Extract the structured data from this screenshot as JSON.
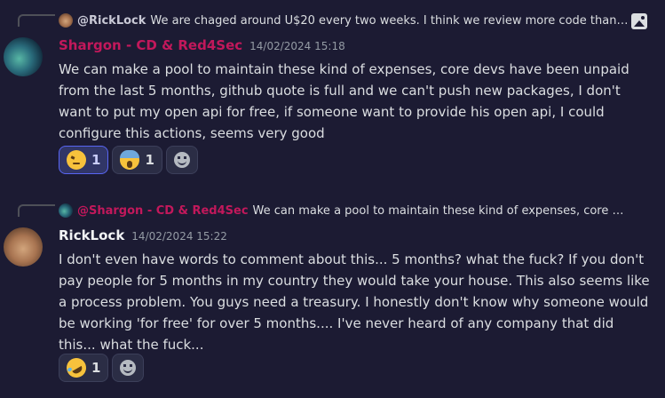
{
  "messages": [
    {
      "reply": {
        "author": "@RickLock",
        "text": "We are chaged around U$20 every two weeks. I think we review more code than ..."
      },
      "author": "Shargon - CD & Red4Sec",
      "author_color": "#c2185b",
      "timestamp": "14/02/2024 15:18",
      "content": "We can make a pool to maintain these kind of expenses, core devs have been unpaid from the last 5 months, github quote is full and we can't push new packages, I don't want to put my open api for free, if someone want to provide his open api, I could configure this actions, seems very good",
      "reactions": [
        {
          "emoji": "angry-face-emoji",
          "count": "1",
          "me": true
        },
        {
          "emoji": "screaming-face-emoji",
          "count": "1",
          "me": false
        }
      ]
    },
    {
      "reply": {
        "author": "@Shargon - CD & Red4Sec",
        "text": "We can make a pool to maintain these kind of expenses, core devs ha..."
      },
      "author": "RickLock",
      "author_color": "#f2f3f5",
      "timestamp": "14/02/2024 15:22",
      "content": "I don't even have words to comment about this... 5 months? what the fuck? If you don't pay people for 5 months in my country they would take your house. This also seems like a process problem. You guys need a treasury. I honestly don't know why someone would be working 'for free' for over 5 months.... I've never heard of any company that did this... what the fuck...",
      "reactions": [
        {
          "emoji": "rofl-emoji",
          "count": "1",
          "me": false
        }
      ]
    }
  ],
  "colors": {
    "background": "#1c1b33",
    "accent": "#5865f2",
    "text": "#dbdee1",
    "muted": "#949ba4"
  }
}
